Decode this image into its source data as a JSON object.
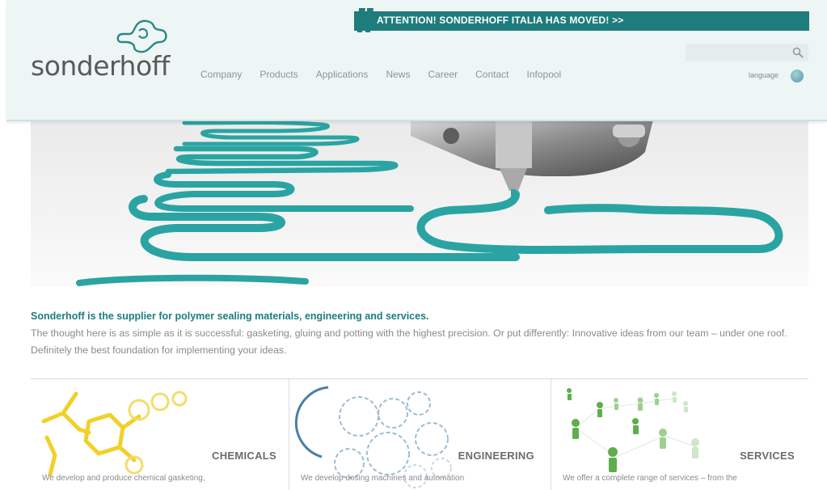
{
  "header": {
    "logo_text": "sonderhoff",
    "attention_text": "ATTENTION! SONDERHOFF ITALIA HAS MOVED! >>",
    "search": {
      "placeholder": "",
      "value": ""
    },
    "nav": [
      "Company",
      "Products",
      "Applications",
      "News",
      "Career",
      "Contact",
      "Infopool"
    ],
    "language_label": "language"
  },
  "intro": {
    "title": "Sonderhoff is the supplier for polymer sealing materials, engineering and services.",
    "text": "The thought here is as simple as it is successful: gasketing, gluing and potting with the highest precision. Or put differently: Innovative ideas from our team – under one roof. Definitely the best foundation for implementing your ideas."
  },
  "boxes": [
    {
      "title": "CHEMICALS",
      "text": "We develop and produce chemical gasketing,"
    },
    {
      "title": "ENGINEERING",
      "text": "We develop dosing machines and automation"
    },
    {
      "title": "SERVICES",
      "text": "We offer a complete range of services – from the"
    }
  ],
  "colors": {
    "brand_teal": "#1e7c7d",
    "header_bg": "#eef5f5",
    "chemicals_yellow": "#f0d12a",
    "engineering_blue": "#7fa9c4",
    "services_green": "#5fae4c"
  },
  "icons": [
    "logo-mark-icon",
    "attention-bang-icon",
    "search-icon",
    "globe-icon"
  ]
}
